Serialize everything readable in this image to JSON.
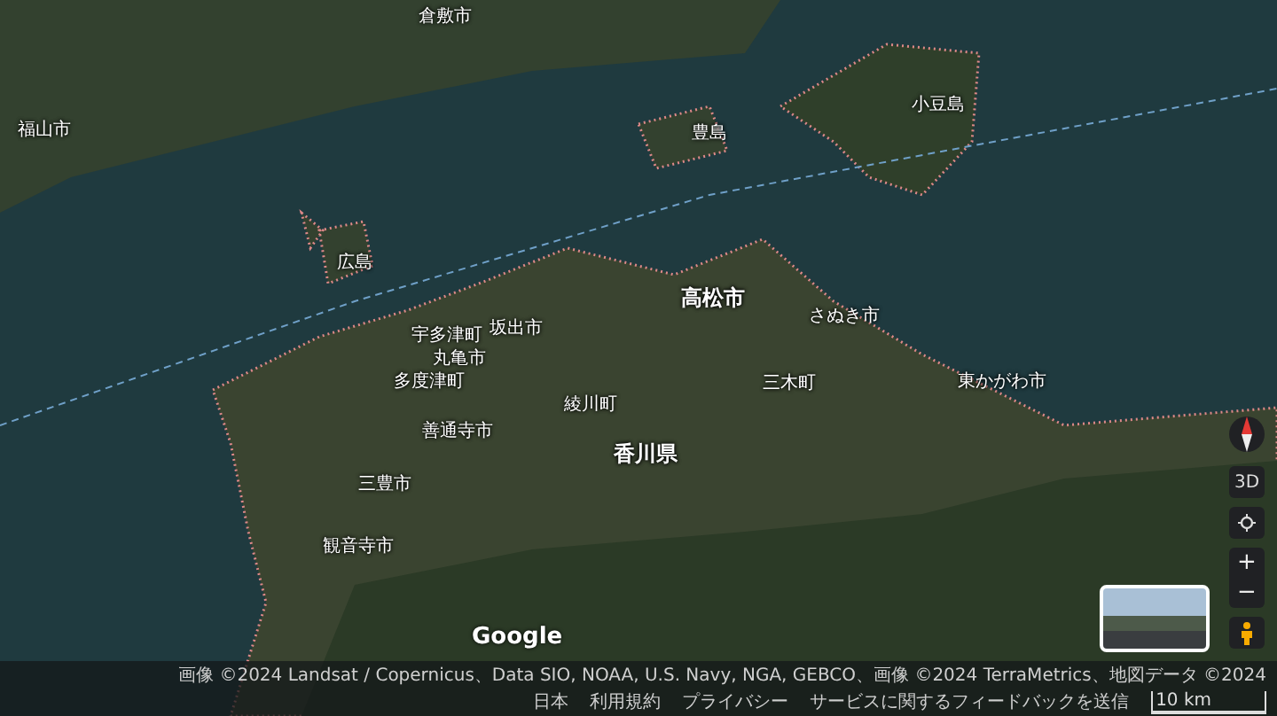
{
  "map": {
    "labels": [
      {
        "text": "倉敷市",
        "kind": "city"
      },
      {
        "text": "福山市",
        "kind": "city"
      },
      {
        "text": "小豆島",
        "kind": "town"
      },
      {
        "text": "豊島",
        "kind": "town"
      },
      {
        "text": "広島",
        "kind": "town"
      },
      {
        "text": "高松市",
        "kind": "major"
      },
      {
        "text": "さぬき市",
        "kind": "city"
      },
      {
        "text": "坂出市",
        "kind": "city"
      },
      {
        "text": "宇多津町",
        "kind": "town"
      },
      {
        "text": "丸亀市",
        "kind": "city"
      },
      {
        "text": "多度津町",
        "kind": "town"
      },
      {
        "text": "綾川町",
        "kind": "town"
      },
      {
        "text": "三木町",
        "kind": "town"
      },
      {
        "text": "善通寺市",
        "kind": "city"
      },
      {
        "text": "香川県",
        "kind": "region"
      },
      {
        "text": "東かがわ市",
        "kind": "city"
      },
      {
        "text": "三豊市",
        "kind": "city"
      },
      {
        "text": "観音寺市",
        "kind": "city"
      }
    ]
  },
  "logo": "Google",
  "controls": {
    "threed": "3D",
    "zoom_in": "+",
    "zoom_out": "−"
  },
  "footer": {
    "attribution": "画像 ©2024 Landsat / Copernicus、Data SIO, NOAA, U.S. Navy, NGA, GEBCO、画像 ©2024 TerraMetrics、地図データ ©2024",
    "links": [
      "日本",
      "利用規約",
      "プライバシー",
      "サービスに関するフィードバックを送信"
    ],
    "scale": "10 km"
  }
}
